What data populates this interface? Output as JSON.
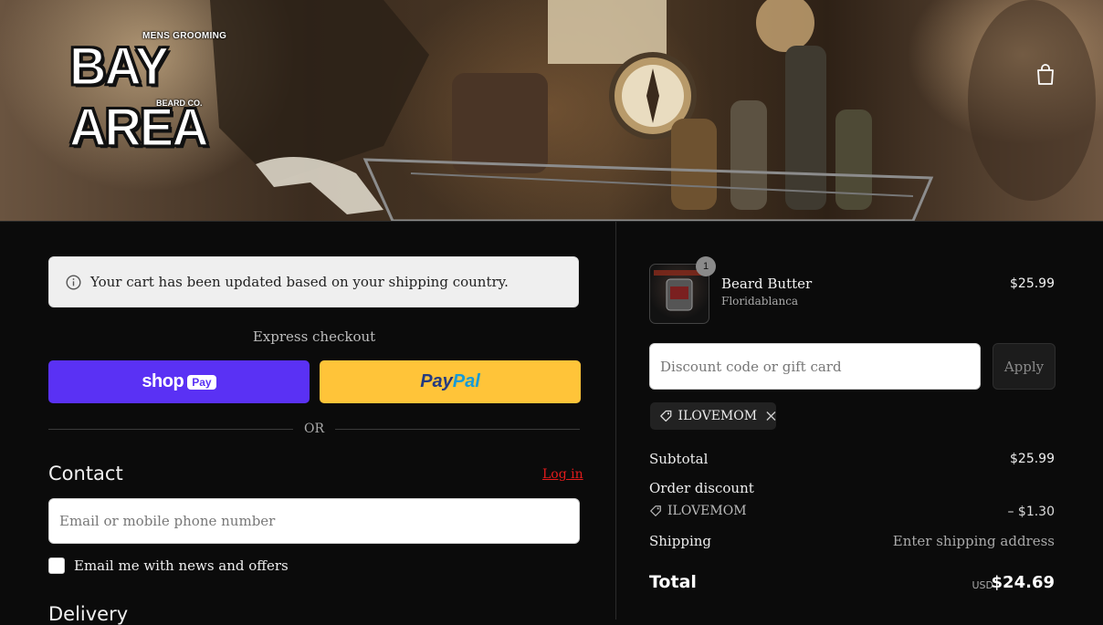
{
  "header": {
    "logo": {
      "top_text": "MENS GROOMING",
      "main_text": "BAY AREA",
      "bottom_text": "BEARD CO."
    },
    "cart_icon": "shopping-bag-icon"
  },
  "notice": {
    "icon": "info-icon",
    "text": "Your cart has been updated based on your shipping country."
  },
  "express_checkout": {
    "label": "Express checkout",
    "shop_pay": {
      "word": "shop",
      "pill": "Pay"
    },
    "paypal": {
      "part1": "Pay",
      "part2": "Pal"
    },
    "separator": "OR"
  },
  "contact": {
    "heading": "Contact",
    "login_link": "Log in",
    "email_placeholder": "Email or mobile phone number",
    "newsletter_label": "Email me with news and offers"
  },
  "delivery": {
    "heading": "Delivery"
  },
  "order_summary": {
    "item": {
      "name": "Beard Butter",
      "variant": "Floridablanca",
      "price": "$25.99",
      "quantity": "1"
    },
    "discount": {
      "placeholder": "Discount code or gift card",
      "apply_label": "Apply",
      "applied_code": "ILOVEMOM"
    },
    "subtotal_label": "Subtotal",
    "subtotal_value": "$25.99",
    "order_discount_label": "Order discount",
    "order_discount_code": "ILOVEMOM",
    "order_discount_value": "– $1.30",
    "shipping_label": "Shipping",
    "shipping_value": "Enter shipping address",
    "total_label": "Total",
    "total_currency": "USD",
    "total_value": "$24.69"
  },
  "colors": {
    "background": "#0b0b0b",
    "shop_pay": "#5a31f4",
    "paypal": "#ffc439",
    "login_link": "#e31b1b"
  }
}
